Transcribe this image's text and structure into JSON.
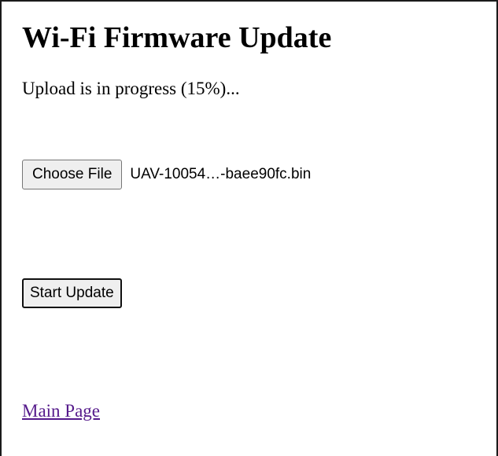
{
  "page": {
    "title": "Wi-Fi Firmware Update",
    "status_text": "Upload is in progress (15%)...",
    "upload_progress_percent": 15
  },
  "file_input": {
    "button_label": "Choose File",
    "selected_file": "UAV-10054…-baee90fc.bin"
  },
  "actions": {
    "start_update_label": "Start Update"
  },
  "links": {
    "main_page_label": "Main Page"
  },
  "colors": {
    "visited_link": "#551a8b",
    "button_background": "#efefef"
  }
}
